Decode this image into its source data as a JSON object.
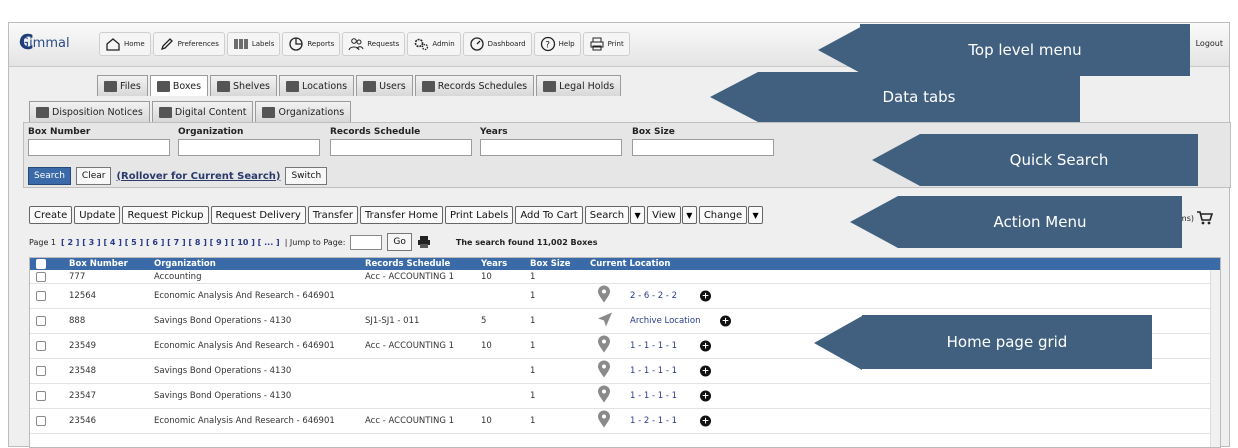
{
  "app": {
    "logo_c": "C",
    "logo_name": "Gimmal",
    "logout": "Logout"
  },
  "top_menu": [
    {
      "label": "Home",
      "icon": "home-icon"
    },
    {
      "label": "Preferences",
      "icon": "pencil-icon"
    },
    {
      "label": "Labels",
      "icon": "barcode-icon"
    },
    {
      "label": "Reports",
      "icon": "pie-chart-icon"
    },
    {
      "label": "Requests",
      "icon": "people-icon"
    },
    {
      "label": "Admin",
      "icon": "gears-icon"
    },
    {
      "label": "Dashboard",
      "icon": "gauge-icon"
    },
    {
      "label": "Help",
      "icon": "help-icon"
    },
    {
      "label": "Print",
      "icon": "printer-icon"
    }
  ],
  "tabs_row1": [
    "Files",
    "Boxes",
    "Shelves",
    "Locations",
    "Users",
    "Records Schedules",
    "Legal Holds"
  ],
  "tabs_row2": [
    "Disposition Notices",
    "Digital Content",
    "Organizations"
  ],
  "active_tab": "Boxes",
  "search": {
    "fields": [
      {
        "label": "Box Number",
        "value": ""
      },
      {
        "label": "Organization",
        "value": ""
      },
      {
        "label": "Records Schedule",
        "value": ""
      },
      {
        "label": "Years",
        "value": ""
      },
      {
        "label": "Box Size",
        "value": ""
      }
    ],
    "search_label": "Search",
    "clear_label": "Clear",
    "rollover_label": "(Rollover for Current Search)",
    "switch_label": "Switch"
  },
  "actions": [
    "Create",
    "Update",
    "Request Pickup",
    "Request Delivery",
    "Transfer",
    "Transfer Home",
    "Print Labels",
    "Add To Cart"
  ],
  "action_dropdowns": [
    "Search",
    "View",
    "Change"
  ],
  "cart": {
    "items": "(4 items)"
  },
  "pager": {
    "page_label": "Page 1",
    "pages": "[ 2 ] [ 3 ] [ 4 ] [ 5 ] [ 6 ] [ 7 ] [ 8 ] [ 9 ] [ 10 ] [ ... ]",
    "jump_label": "| Jump to Page:",
    "go_label": "Go",
    "found": "The search found  11,002 Boxes"
  },
  "grid": {
    "columns": [
      "Box Number",
      "Organization",
      "Records Schedule",
      "Years",
      "Box Size",
      "Current Location"
    ],
    "rows": [
      {
        "box": "777",
        "org": "Accounting",
        "schedule": "Acc - ACCOUNTING 1",
        "years": "10",
        "size": "1",
        "location": "",
        "loc_icon": "",
        "plus": false
      },
      {
        "box": "12564",
        "org": "Economic Analysis And Research - 646901",
        "schedule": "",
        "years": "",
        "size": "1",
        "location": "2 - 6 - 2 - 2",
        "loc_icon": "map-pin-icon",
        "plus": true
      },
      {
        "box": "888",
        "org": "Savings Bond Operations - 4130",
        "schedule": "SJ1-SJ1 - 011",
        "years": "5",
        "size": "1",
        "location": "Archive Location",
        "loc_icon": "navigation-arrow-icon",
        "plus": true
      },
      {
        "box": "23549",
        "org": "Economic Analysis And Research - 646901",
        "schedule": "Acc - ACCOUNTING 1",
        "years": "10",
        "size": "1",
        "location": "1 - 1 - 1 - 1",
        "loc_icon": "map-pin-icon",
        "plus": true
      },
      {
        "box": "23548",
        "org": "Savings Bond Operations - 4130",
        "schedule": "",
        "years": "",
        "size": "1",
        "location": "1 - 1 - 1 - 1",
        "loc_icon": "map-pin-icon",
        "plus": true
      },
      {
        "box": "23547",
        "org": "Savings Bond Operations - 4130",
        "schedule": "",
        "years": "",
        "size": "1",
        "location": "1 - 1 - 1 - 1",
        "loc_icon": "map-pin-icon",
        "plus": true
      },
      {
        "box": "23546",
        "org": "Economic Analysis And Research - 646901",
        "schedule": "Acc - ACCOUNTING 1",
        "years": "10",
        "size": "1",
        "location": "1 - 2 - 1 - 1",
        "loc_icon": "map-pin-icon",
        "plus": true
      }
    ]
  },
  "annotations": [
    "Top level menu",
    "Data tabs",
    "Quick Search",
    "Action Menu",
    "Home page grid"
  ],
  "colors": {
    "annotation": "#41607f",
    "grid_header": "#3a6aa8",
    "link": "#2a3a8a"
  }
}
